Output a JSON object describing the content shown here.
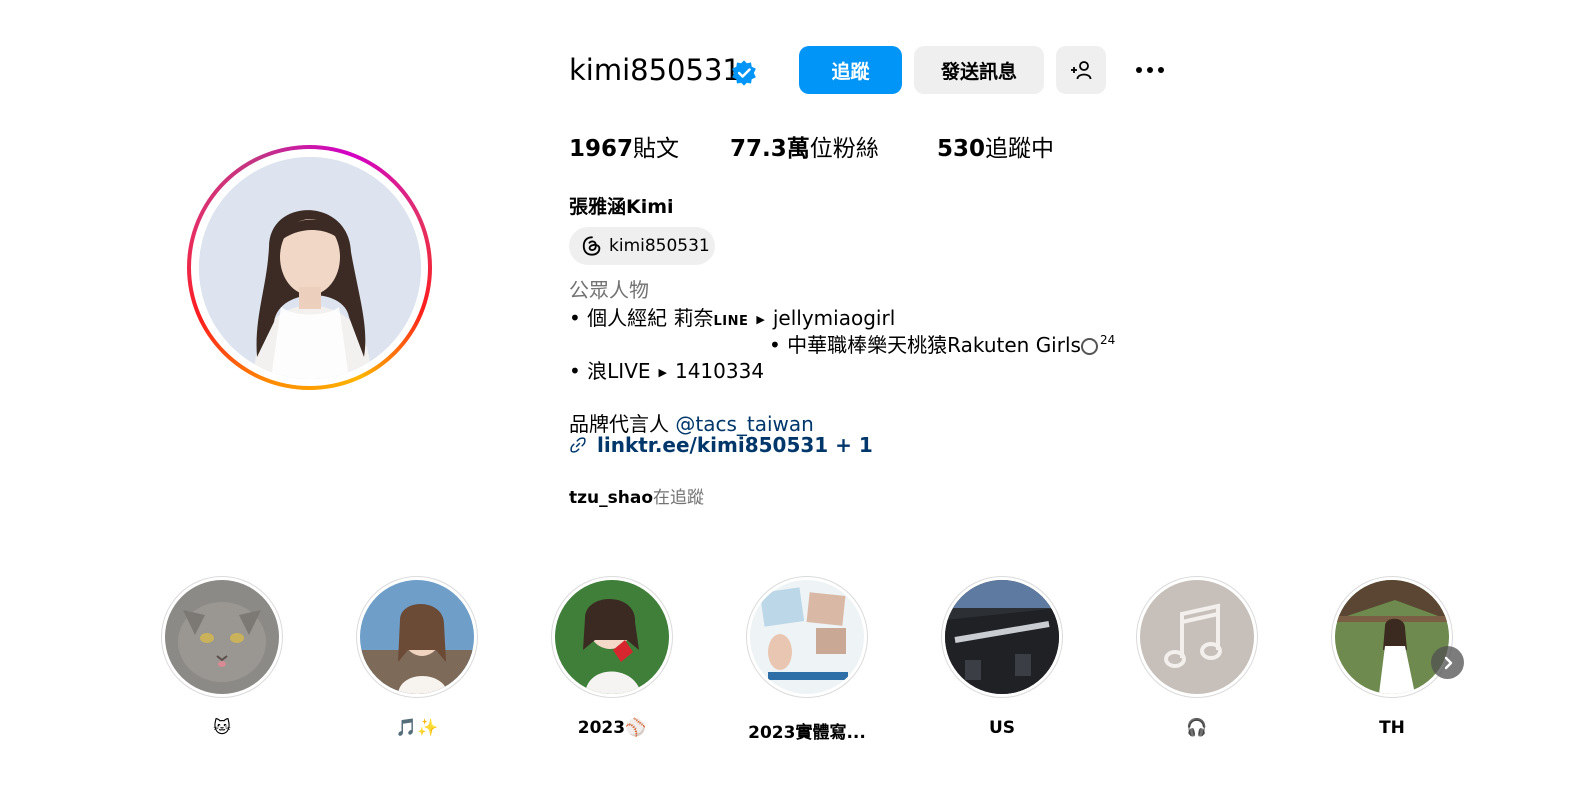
{
  "profile": {
    "username": "kimi850531",
    "verified": true,
    "full_name": "張雅涵Kimi",
    "threads_handle": "kimi850531",
    "category": "公眾人物"
  },
  "actions": {
    "follow_label": "追蹤",
    "message_label": "發送訊息"
  },
  "stats": {
    "posts_count": "1967",
    "posts_label": "貼文",
    "followers_count": "77.3萬",
    "followers_label": "位粉絲",
    "following_count": "530",
    "following_label": "追蹤中"
  },
  "bio": {
    "line1_prefix": "• 個人經紀 莉奈",
    "line1_logo": "LINE",
    "line1_value": "jellymiaogirl",
    "line2_text": "• 中華職棒樂天桃猿Rakuten Girls",
    "line2_sup": "24",
    "line3_prefix": "• 浪LIVE",
    "line3_value": "1410334",
    "line4_prefix": "品牌代言人 ",
    "line4_mention": "@tacs_taiwan",
    "external_link": "linktr.ee/kimi850531 + 1"
  },
  "followed_by": {
    "user": "tzu_shao",
    "suffix": "在追蹤"
  },
  "highlights": [
    {
      "label": "🐱"
    },
    {
      "label": "🎵✨"
    },
    {
      "label": "2023⚾"
    },
    {
      "label": "2023實體寫..."
    },
    {
      "label": "US"
    },
    {
      "label": "🎧"
    },
    {
      "label": "TH"
    }
  ],
  "colors": {
    "accent": "#0095f6",
    "link": "#00376b",
    "secondary_text": "#737373",
    "button_bg": "#efefef"
  }
}
